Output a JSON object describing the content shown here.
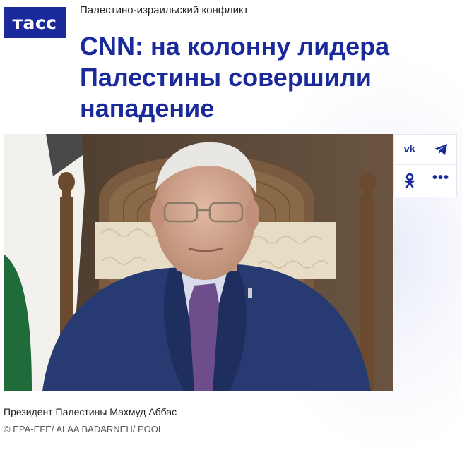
{
  "logo": {
    "text": "тасс"
  },
  "rubric": "Палестино-израильский конфликт",
  "headline": {
    "lines": [
      "CNN: на колонну лидера",
      "Палестины совершили",
      "нападение"
    ]
  },
  "share": {
    "vk_label": "vk",
    "telegram_icon": "telegram-icon",
    "ok_icon": "odnoklassniki-icon",
    "more_label": "•••"
  },
  "photo": {
    "caption": "Президент Палестины Махмуд Аббас",
    "credit": "© EPA-EFE/ ALAA BADARNEH/ POOL"
  },
  "colors": {
    "brand": "#1b2a9b",
    "text": "#222222",
    "credit": "#555555"
  }
}
